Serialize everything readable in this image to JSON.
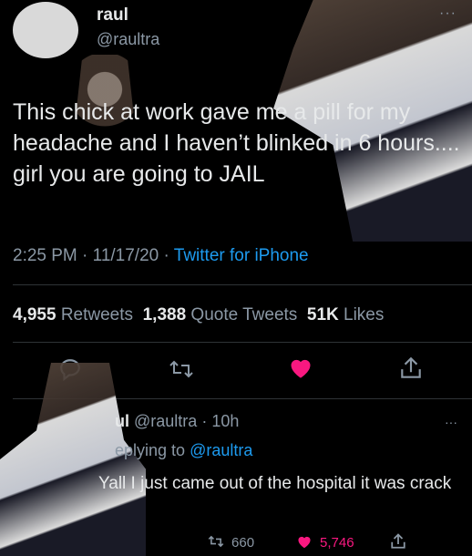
{
  "tweet": {
    "author_name": "raul",
    "author_handle": "@raultra",
    "text": "This chick at work gave me a pill for my headache and I haven’t blinked in 6 hours.... girl you are going to JAIL",
    "time": "2:25 PM",
    "date": "11/17/20",
    "source": "Twitter for iPhone",
    "separator": "·",
    "more_glyph": "···",
    "stats": {
      "retweets_count": "4,955",
      "retweets_label": "Retweets",
      "quotes_count": "1,388",
      "quotes_label": "Quote Tweets",
      "likes_count": "51K",
      "likes_label": "Likes"
    },
    "liked_color": "#f91880"
  },
  "reply": {
    "author_partial": "ul",
    "author_handle": "@raultra",
    "age": "10h",
    "replying_prefix": "eplying to",
    "replying_to": "@raultra",
    "text": "Yall I just came out of the hospital it was crack",
    "retweets": "660",
    "likes": "5,746",
    "more_glyph": "···"
  },
  "icons": {
    "reply": "reply-icon",
    "retweet": "retweet-icon",
    "like": "heart-icon",
    "share": "share-icon"
  }
}
